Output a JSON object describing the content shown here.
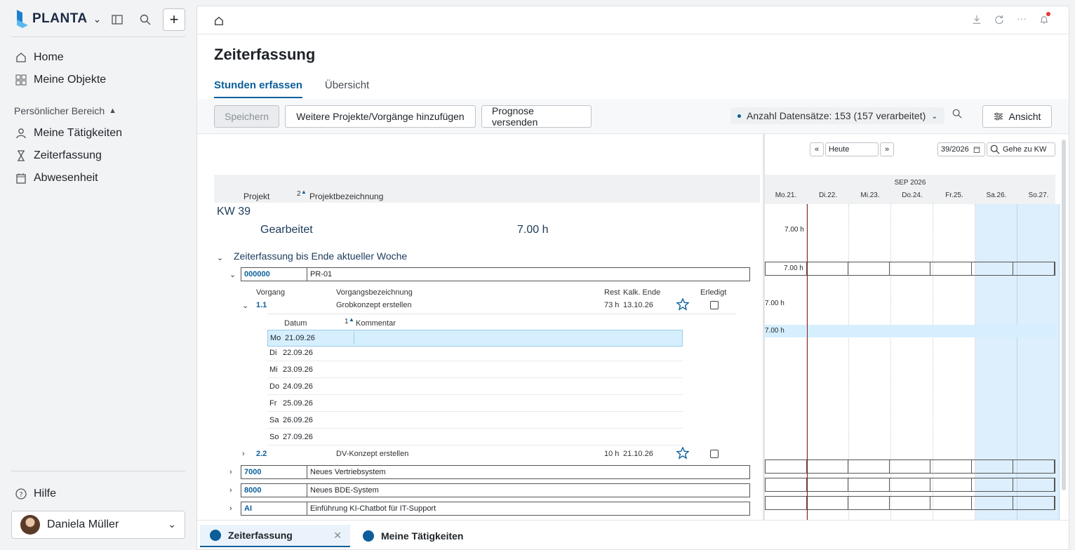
{
  "brand": {
    "name": "PLANTA"
  },
  "sidebar": {
    "nav": [
      {
        "label": "Home",
        "icon": "home-icon"
      },
      {
        "label": "Meine Objekte",
        "icon": "grid-icon"
      }
    ],
    "section_label": "Persönlicher Bereich",
    "personal": [
      {
        "label": "Meine Tätigkeiten",
        "icon": "user-icon"
      },
      {
        "label": "Zeiterfassung",
        "icon": "hourglass-icon"
      },
      {
        "label": "Abwesenheit",
        "icon": "calendar-icon"
      }
    ],
    "help_label": "Hilfe",
    "user_name": "Daniela Müller"
  },
  "page": {
    "title": "Zeiterfassung",
    "tabs": [
      "Stunden erfassen",
      "Übersicht"
    ]
  },
  "toolbar": {
    "save_label": "Speichern",
    "add_label": "Weitere Projekte/Vorgänge hinzufügen",
    "forecast_label": "Prognose versenden",
    "count_label": "Anzahl Datensätze: 153 (157 verarbeitet)",
    "view_label": "Ansicht"
  },
  "table": {
    "col_project": "Projekt",
    "sort_num": "2",
    "col_project_name": "Projektbezeichnung",
    "week": "KW 39",
    "worked_label": "Gearbeitet",
    "worked_value": "7.00 h",
    "group_label": "Zeiterfassung bis Ende aktueller Woche",
    "proj1_id": "000000",
    "proj1_name": "PR-01",
    "sub_cols": {
      "vorgang": "Vorgang",
      "bezeichnung": "Vorgangsbezeichnung",
      "rest": "Rest",
      "ende": "Kalk. Ende",
      "erledigt": "Erledigt"
    },
    "task1": {
      "id": "1.1",
      "name": "Grobkonzept erstellen",
      "rest": "73 h",
      "ende": "13.10.26"
    },
    "day_cols": {
      "datum": "Datum",
      "sort_num": "1",
      "kommentar": "Kommentar"
    },
    "days": [
      {
        "d": "Mo",
        "date": "21.09.26"
      },
      {
        "d": "Di",
        "date": "22.09.26"
      },
      {
        "d": "Mi",
        "date": "23.09.26"
      },
      {
        "d": "Do",
        "date": "24.09.26"
      },
      {
        "d": "Fr",
        "date": "25.09.26"
      },
      {
        "d": "Sa",
        "date": "26.09.26"
      },
      {
        "d": "So",
        "date": "27.09.26"
      }
    ],
    "task2": {
      "id": "2.2",
      "name": "DV-Konzept erstellen",
      "rest": "10 h",
      "ende": "21.10.26"
    },
    "projects": [
      {
        "id": "7000",
        "name": "Neues Vertriebsystem"
      },
      {
        "id": "8000",
        "name": "Neues BDE-System"
      },
      {
        "id": "AI",
        "name": "Einführung KI-Chatbot für IT-Support"
      }
    ]
  },
  "gantt": {
    "prev": "«",
    "today_btn": "Heute",
    "next": "»",
    "week_value": "39/2026",
    "goto_label": "Gehe zu KW",
    "month": "SEP 2026",
    "days": [
      "Mo.21.",
      "Di.22.",
      "Mi.23.",
      "Do.24.",
      "Fr.25.",
      "Sa.26.",
      "So.27."
    ],
    "value": "7.00 h"
  },
  "bottom_tabs": [
    "Zeiterfassung",
    "Meine Tätigkeiten"
  ],
  "colors": {
    "accent": "#0a5f9a",
    "weekend": "#ddeefc",
    "selection": "#d6efff",
    "today_line": "#8b1a1a"
  }
}
